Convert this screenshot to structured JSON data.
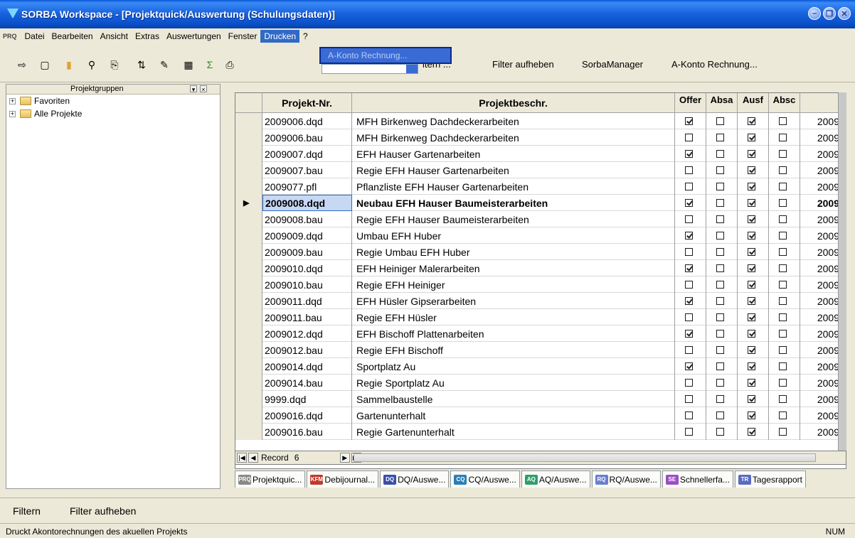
{
  "window": {
    "title": "SORBA Workspace - [Projektquick/Auswertung (Schulungsdaten)]"
  },
  "menu": {
    "logo": "PRQ",
    "items": [
      "Datei",
      "Bearbeiten",
      "Ansicht",
      "Extras",
      "Auswertungen",
      "Fenster",
      "Drucken",
      "?"
    ],
    "open_menu": "Drucken",
    "dropdown_item": "A-Konto Rechnung..."
  },
  "toolbar": {
    "filter_partial": "ltern ...",
    "filter_remove": "Filter aufheben",
    "sorba_manager": "SorbaManager",
    "akonto": "A-Konto Rechnung..."
  },
  "left_panel": {
    "title": "Projektgruppen",
    "tree": [
      "Favoriten",
      "Alle Projekte"
    ]
  },
  "grid": {
    "headers": [
      "Projekt-Nr.",
      "Projektbeschr.",
      "Offer",
      "Absa",
      "Ausf",
      "Absc"
    ],
    "rows": [
      {
        "nr": "2009006.dqd",
        "desc": "MFH Birkenweg Dachdeckerarbeiten",
        "offer": true,
        "absa": false,
        "ausf": true,
        "absc": false,
        "year": "2009"
      },
      {
        "nr": "2009006.bau",
        "desc": "MFH Birkenweg Dachdeckerarbeiten",
        "offer": false,
        "absa": false,
        "ausf": true,
        "absc": false,
        "year": "2009"
      },
      {
        "nr": "2009007.dqd",
        "desc": "EFH Hauser Gartenarbeiten",
        "offer": true,
        "absa": false,
        "ausf": true,
        "absc": false,
        "year": "2009"
      },
      {
        "nr": "2009007.bau",
        "desc": "Regie EFH Hauser Gartenarbeiten",
        "offer": false,
        "absa": false,
        "ausf": true,
        "absc": false,
        "year": "2009"
      },
      {
        "nr": "2009077.pfl",
        "desc": "Pflanzliste EFH Hauser Gartenarbeiten",
        "offer": false,
        "absa": false,
        "ausf": true,
        "absc": false,
        "year": "2009"
      },
      {
        "nr": "2009008.dqd",
        "desc": "Neubau EFH Hauser Baumeisterarbeiten",
        "offer": true,
        "absa": false,
        "ausf": true,
        "absc": false,
        "year": "2009",
        "current": true
      },
      {
        "nr": "2009008.bau",
        "desc": "Regie EFH Hauser Baumeisterarbeiten",
        "offer": false,
        "absa": false,
        "ausf": true,
        "absc": false,
        "year": "2009"
      },
      {
        "nr": "2009009.dqd",
        "desc": "Umbau EFH Huber",
        "offer": true,
        "absa": false,
        "ausf": true,
        "absc": false,
        "year": "2009"
      },
      {
        "nr": "2009009.bau",
        "desc": "Regie Umbau EFH Huber",
        "offer": false,
        "absa": false,
        "ausf": true,
        "absc": false,
        "year": "2009"
      },
      {
        "nr": "2009010.dqd",
        "desc": "EFH Heiniger Malerarbeiten",
        "offer": true,
        "absa": false,
        "ausf": true,
        "absc": false,
        "year": "2009"
      },
      {
        "nr": "2009010.bau",
        "desc": "Regie EFH Heiniger",
        "offer": false,
        "absa": false,
        "ausf": true,
        "absc": false,
        "year": "2009"
      },
      {
        "nr": "2009011.dqd",
        "desc": "EFH Hüsler Gipserarbeiten",
        "offer": true,
        "absa": false,
        "ausf": true,
        "absc": false,
        "year": "2009"
      },
      {
        "nr": "2009011.bau",
        "desc": "Regie EFH Hüsler",
        "offer": false,
        "absa": false,
        "ausf": true,
        "absc": false,
        "year": "2009"
      },
      {
        "nr": "2009012.dqd",
        "desc": "EFH Bischoff Plattenarbeiten",
        "offer": true,
        "absa": false,
        "ausf": true,
        "absc": false,
        "year": "2009"
      },
      {
        "nr": "2009012.bau",
        "desc": "Regie EFH Bischoff",
        "offer": false,
        "absa": false,
        "ausf": true,
        "absc": false,
        "year": "2009"
      },
      {
        "nr": "2009014.dqd",
        "desc": "Sportplatz Au",
        "offer": true,
        "absa": false,
        "ausf": true,
        "absc": false,
        "year": "2009"
      },
      {
        "nr": "2009014.bau",
        "desc": "Regie Sportplatz Au",
        "offer": false,
        "absa": false,
        "ausf": true,
        "absc": false,
        "year": "2009"
      },
      {
        "nr": "9999.dqd",
        "desc": "Sammelbaustelle",
        "offer": false,
        "absa": false,
        "ausf": true,
        "absc": false,
        "year": "2009"
      },
      {
        "nr": "2009016.dqd",
        "desc": "Gartenunterhalt",
        "offer": false,
        "absa": false,
        "ausf": true,
        "absc": false,
        "year": "2009"
      },
      {
        "nr": "2009016.bau",
        "desc": "Regie Gartenunterhalt",
        "offer": false,
        "absa": false,
        "ausf": true,
        "absc": false,
        "year": "2009"
      }
    ]
  },
  "navigator": {
    "label": "Record",
    "value": "6"
  },
  "tabs": [
    {
      "badge": "PRQ",
      "label": "Projektquic...",
      "color": "#888888"
    },
    {
      "badge": "KFM",
      "label": "Debijournal...",
      "color": "#c0392b"
    },
    {
      "badge": "DQ",
      "label": "DQ/Auswe...",
      "color": "#3b4ea8"
    },
    {
      "badge": "CQ",
      "label": "CQ/Auswe...",
      "color": "#2a7fb5"
    },
    {
      "badge": "AQ",
      "label": "AQ/Auswe...",
      "color": "#2e9e6a"
    },
    {
      "badge": "RQ",
      "label": "RQ/Auswe...",
      "color": "#6a7fd0"
    },
    {
      "badge": "SE",
      "label": "Schnellerfa...",
      "color": "#9b4fc2"
    },
    {
      "badge": "TR",
      "label": "Tagesrapport",
      "color": "#5a6bc0"
    }
  ],
  "bottom": {
    "filter": "Filtern",
    "filter_remove": "Filter aufheben"
  },
  "status": {
    "text": "Druckt Akontorechnungen des akuellen Projekts",
    "num": "NUM"
  }
}
